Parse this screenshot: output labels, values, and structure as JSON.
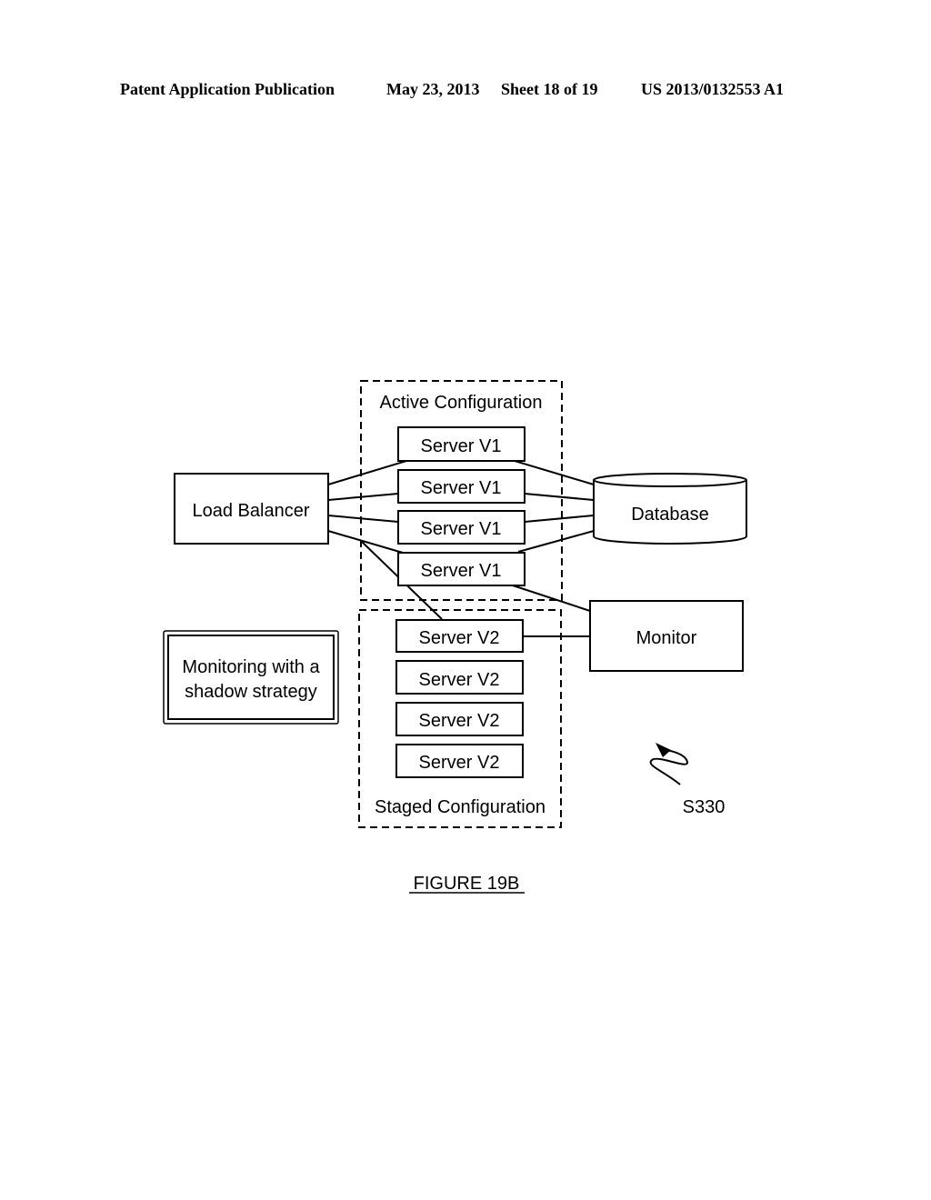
{
  "header": {
    "publication": "Patent Application Publication",
    "date": "May 23, 2013",
    "sheet": "Sheet 18 of 19",
    "patent_number": "US 2013/0132553 A1"
  },
  "diagram": {
    "load_balancer": "Load Balancer",
    "active_configuration": {
      "label": "Active Configuration",
      "servers": [
        "Server V1",
        "Server V1",
        "Server V1",
        "Server V1"
      ]
    },
    "staged_configuration": {
      "label": "Staged Configuration",
      "servers": [
        "Server V2",
        "Server V2",
        "Server V2",
        "Server V2"
      ]
    },
    "database": "Database",
    "monitor": "Monitor",
    "strategy_label_line1": "Monitoring with a",
    "strategy_label_line2": "shadow strategy",
    "reference": "S330"
  },
  "figure_caption": "FIGURE 19B"
}
